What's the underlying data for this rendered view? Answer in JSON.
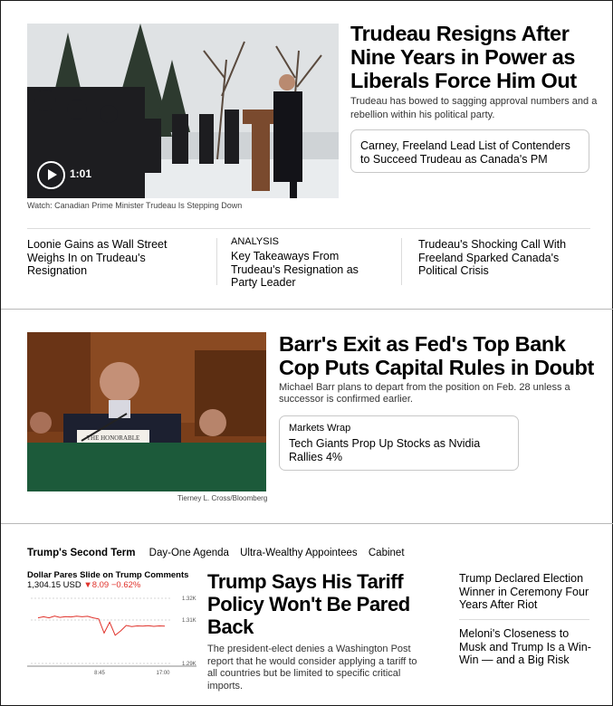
{
  "story1": {
    "headline": "Trudeau Resigns After Nine Years in Power as Liberals Force Him Out",
    "dek": "Trudeau has bowed to sagging approval numbers and a rebellion within his political party.",
    "video_duration": "1:01",
    "video_caption": "Watch: Canadian Prime Minister Trudeau Is Stepping Down",
    "related_card": "Carney, Freeland Lead List of Contenders to Succeed Trudeau as Canada's PM",
    "subs": [
      {
        "kicker": "",
        "headline": "Loonie Gains as Wall Street Weighs In on Trudeau's Resignation"
      },
      {
        "kicker": "ANALYSIS",
        "headline": "Key Takeaways From Trudeau's Resignation as Party Leader"
      },
      {
        "kicker": "",
        "headline": "Trudeau's Shocking Call With Freeland Sparked Canada's Political Crisis"
      }
    ]
  },
  "story2": {
    "headline": "Barr's Exit as Fed's Top Bank Cop Puts Capital Rules in Doubt",
    "dek": "Michael Barr plans to depart from the position on Feb. 28 unless a successor is confirmed earlier.",
    "photo_credit": "Tierney L. Cross/Bloomberg",
    "nameplate": "THE HONORABLE",
    "card_kicker": "Markets Wrap",
    "card_headline": "Tech Giants Prop Up Stocks as Nvidia Rallies 4%"
  },
  "story3": {
    "section_label": "Trump's Second Term",
    "nav_items": [
      "Day-One Agenda",
      "Ultra-Wealthy Appointees",
      "Cabinet"
    ],
    "chart_title": "Dollar Pares Slide on Trump Comments",
    "chart_price": "1,304.15 USD",
    "chart_change": "▼8.09 −0.62%",
    "headline": "Trump Says His Tariff Policy Won't Be Pared Back",
    "dek": "The president-elect denies a Washington Post report that he would consider applying a tariff to all countries but be limited to specific critical imports.",
    "sidebar": [
      "Trump Declared Election Winner in Ceremony Four Years After Riot",
      "Meloni's Closeness to Musk and Trump Is a Win-Win — and a Big Risk"
    ]
  },
  "chart_data": {
    "type": "line",
    "title": "Dollar Pares Slide on Trump Comments",
    "x_tick_labels": [
      "8:45",
      "17:00"
    ],
    "y_tick_labels": [
      "1.32K",
      "1.31K",
      "1.29K"
    ],
    "ylim": [
      1290,
      1320
    ],
    "grid": true,
    "series": [
      {
        "color": "#e0322b",
        "values": [
          1311,
          1311.5,
          1311,
          1311.8,
          1311.2,
          1311.6,
          1311.4,
          1311.8,
          1311.5,
          1311.7,
          1311,
          1310.5,
          1304,
          1309,
          1303,
          1305,
          1307.5,
          1307,
          1307.3,
          1307.2,
          1307.4,
          1307.1,
          1307.3,
          1307.2
        ]
      }
    ]
  }
}
